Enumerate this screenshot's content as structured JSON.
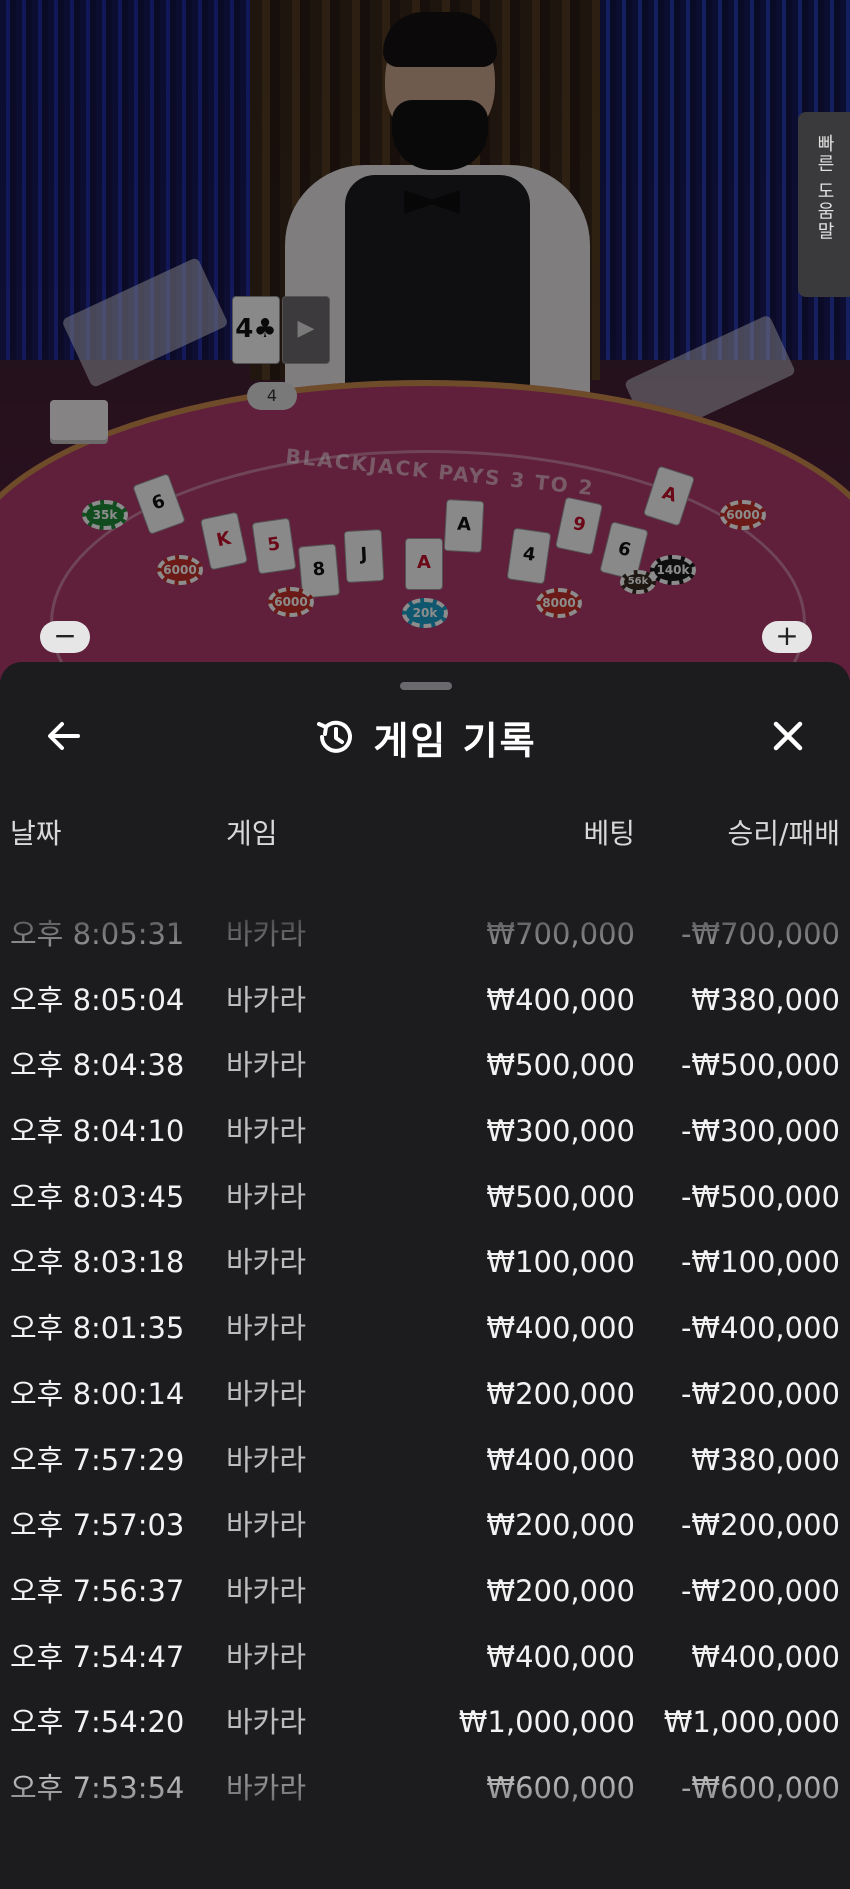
{
  "help_tab": {
    "label": "빠른 도움말"
  },
  "table": {
    "banner": "BLACKJACK PAYS 3 TO 2",
    "dealer_cards": [
      "4♣",
      "▶"
    ],
    "dealer_score": "4",
    "chips": [
      "35k",
      "6000",
      "6000",
      "20k",
      "8000",
      "56k",
      "140k",
      "6000"
    ],
    "zoom_out_label": "−",
    "zoom_in_label": "+"
  },
  "sheet": {
    "title": "게임 기록",
    "columns": {
      "date": "날짜",
      "game": "게임",
      "bet": "베팅",
      "result": "승리/패배"
    },
    "rows": [
      {
        "date": "오후 8:05:31",
        "game": "바카라",
        "bet": "₩700,000",
        "result": "-₩700,000"
      },
      {
        "date": "오후 8:05:04",
        "game": "바카라",
        "bet": "₩400,000",
        "result": "₩380,000"
      },
      {
        "date": "오후 8:04:38",
        "game": "바카라",
        "bet": "₩500,000",
        "result": "-₩500,000"
      },
      {
        "date": "오후 8:04:10",
        "game": "바카라",
        "bet": "₩300,000",
        "result": "-₩300,000"
      },
      {
        "date": "오후 8:03:45",
        "game": "바카라",
        "bet": "₩500,000",
        "result": "-₩500,000"
      },
      {
        "date": "오후 8:03:18",
        "game": "바카라",
        "bet": "₩100,000",
        "result": "-₩100,000"
      },
      {
        "date": "오후 8:01:35",
        "game": "바카라",
        "bet": "₩400,000",
        "result": "-₩400,000"
      },
      {
        "date": "오후 8:00:14",
        "game": "바카라",
        "bet": "₩200,000",
        "result": "-₩200,000"
      },
      {
        "date": "오후 7:57:29",
        "game": "바카라",
        "bet": "₩400,000",
        "result": "₩380,000"
      },
      {
        "date": "오후 7:57:03",
        "game": "바카라",
        "bet": "₩200,000",
        "result": "-₩200,000"
      },
      {
        "date": "오후 7:56:37",
        "game": "바카라",
        "bet": "₩200,000",
        "result": "-₩200,000"
      },
      {
        "date": "오후 7:54:47",
        "game": "바카라",
        "bet": "₩400,000",
        "result": "₩400,000"
      },
      {
        "date": "오후 7:54:20",
        "game": "바카라",
        "bet": "₩1,000,000",
        "result": "₩1,000,000"
      },
      {
        "date": "오후 7:53:54",
        "game": "바카라",
        "bet": "₩600,000",
        "result": "-₩600,000"
      }
    ]
  },
  "colors": {
    "sheet_bg": "#1c1b1e",
    "text": "#f2f2f2",
    "felt": "#b03a6a"
  },
  "icons": {
    "back": "arrow-left-icon",
    "history": "history-icon",
    "close": "close-icon"
  }
}
